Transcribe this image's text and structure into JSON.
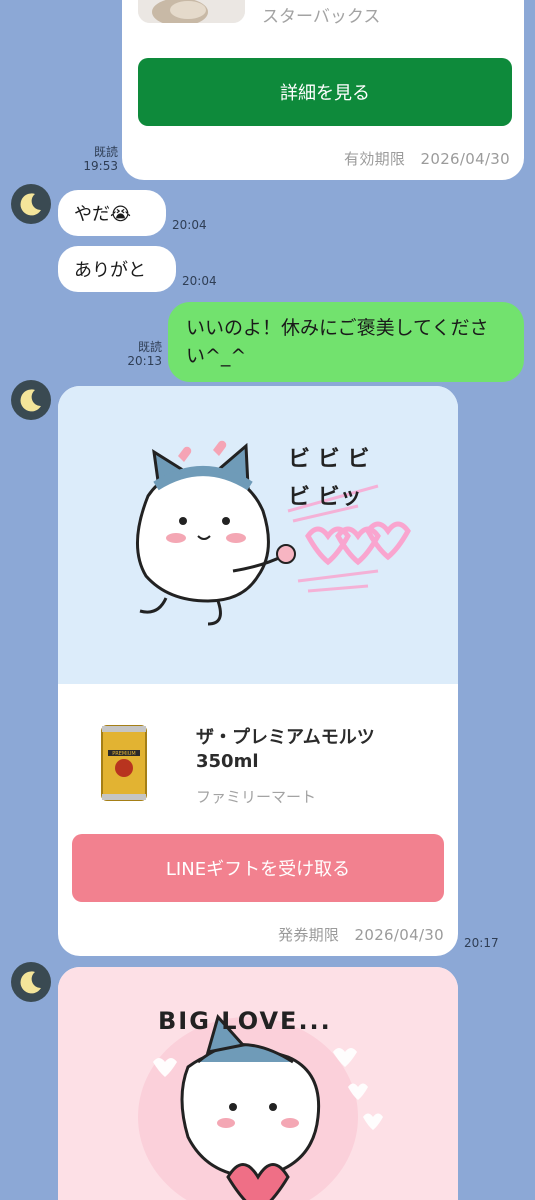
{
  "colors": {
    "background": "#8ca8d6",
    "green_button": "#0e8a3b",
    "pink_button": "#f2818f",
    "my_bubble": "#72e26e"
  },
  "gift_card_top": {
    "store": "スターバックス",
    "button_label": "詳細を見る",
    "expiry": "有効期限　2026/04/30"
  },
  "messages": [
    {
      "side": "left",
      "text": "やだ😭",
      "time": "20:04"
    },
    {
      "side": "left",
      "text": "ありがと",
      "time": "20:04"
    },
    {
      "side": "right",
      "text": "いいのよ！休みにご褒美してください^_^",
      "read": "既読",
      "time": "20:13"
    }
  ],
  "read_receipt_top": {
    "read": "既読",
    "time": "19:53"
  },
  "gift_card_beer": {
    "sticker_text": "ビ ビ ビ ビ ビッ",
    "product_name_line1": "ザ・プレミアムモルツ",
    "product_name_line2": "350ml",
    "store": "ファミリーマート",
    "button_label": "LINEギフトを受け取る",
    "expiry": "発券期限　2026/04/30",
    "time": "20:17",
    "can_text": "PREMIUM"
  },
  "gift_card_love": {
    "sticker_text": "BIG LOVE..."
  },
  "icons": [
    "moon-avatar",
    "crying-emoji",
    "beer-can",
    "sticker-cat"
  ]
}
